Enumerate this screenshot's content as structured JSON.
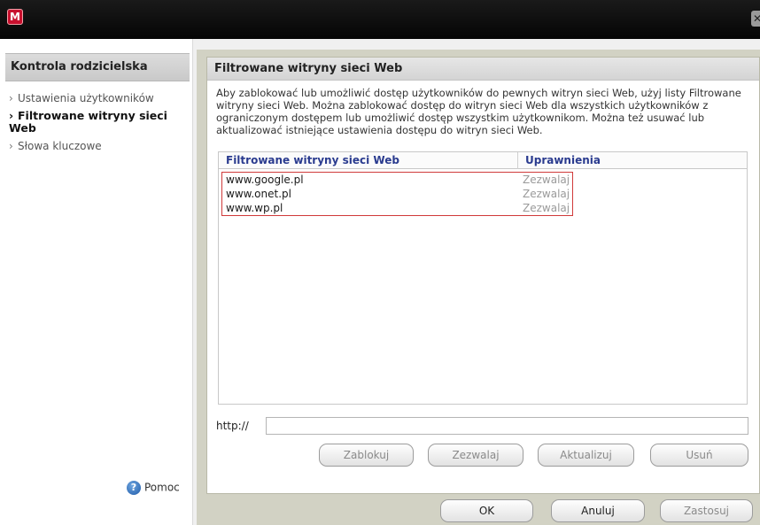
{
  "window": {
    "logo_letter": "M",
    "close_glyph": "✕"
  },
  "sidebar": {
    "title": "Kontrola rodzicielska",
    "items": [
      {
        "label": "Ustawienia użytkowników",
        "active": false
      },
      {
        "label": "Filtrowane witryny sieci Web",
        "active": true
      },
      {
        "label": "Słowa kluczowe",
        "active": false
      }
    ],
    "help_label": "Pomoc"
  },
  "panel": {
    "title": "Filtrowane witryny sieci Web",
    "description": "Aby zablokować lub umożliwić dostęp użytkowników do pewnych witryn sieci Web, użyj listy Filtrowane witryny sieci Web. Można zablokować dostęp do witryn sieci Web dla wszystkich użytkowników z ograniczonym dostępem lub umożliwić dostęp wszystkim użytkownikom. Można też usuwać lub aktualizować istniejące ustawienia dostępu do witryn sieci Web.",
    "table": {
      "columns": [
        "Filtrowane witryny sieci Web",
        "Uprawnienia"
      ],
      "rows": [
        {
          "site": "www.google.pl",
          "permission": "Zezwalaj"
        },
        {
          "site": "www.onet.pl",
          "permission": "Zezwalaj"
        },
        {
          "site": "www.wp.pl",
          "permission": "Zezwalaj"
        }
      ]
    },
    "url_label": "http://",
    "url_value": "",
    "buttons": {
      "block": "Zablokuj",
      "allow": "Zezwalaj",
      "update": "Aktualizuj",
      "delete": "Usuń"
    }
  },
  "footer": {
    "ok": "OK",
    "cancel": "Anuluj",
    "apply": "Zastosuj"
  },
  "icons": {
    "logo": "mcafee-logo-icon",
    "close": "close-icon",
    "help": "help-icon",
    "nav": "chevron-right-icon"
  },
  "colors": {
    "titlebar": "#0a0a0a",
    "logo_red": "#c8102e",
    "header_text": "#2a3b8f",
    "highlight_border": "#d03a3a",
    "disabled_text": "#9a9a9a"
  }
}
